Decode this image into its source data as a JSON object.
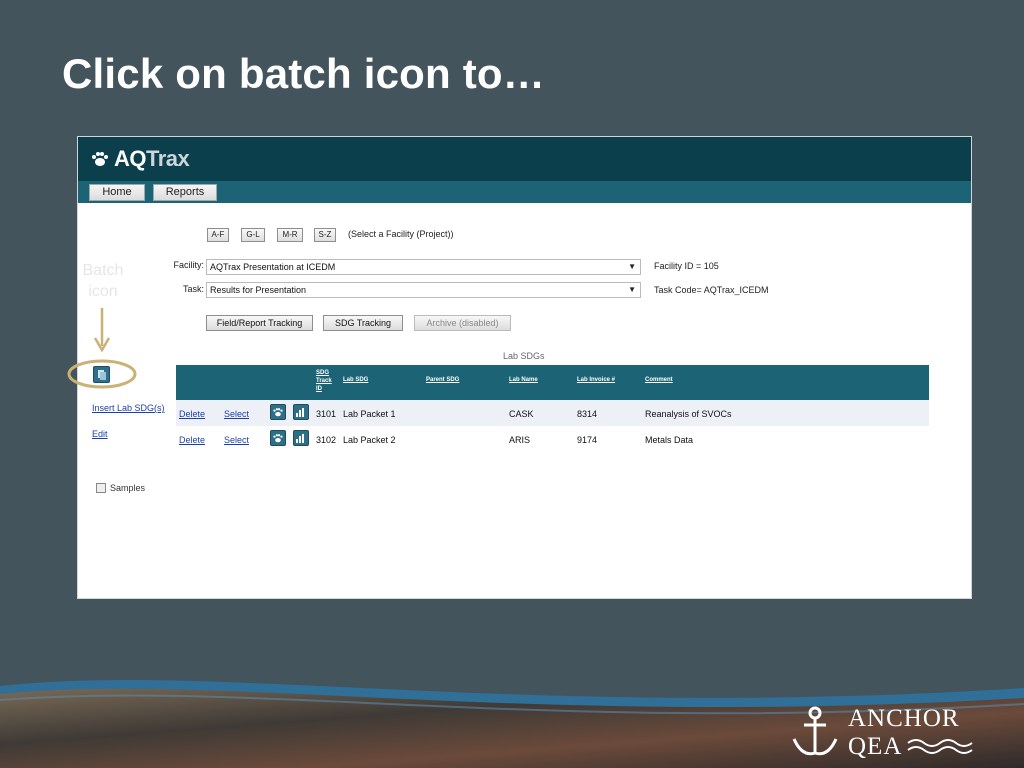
{
  "slide": {
    "title": "Click on batch icon to…"
  },
  "annotation": {
    "batch_line1": "Batch",
    "batch_line2": "icon"
  },
  "app": {
    "logo": {
      "prefix": "AQ",
      "suffix": "Trax"
    },
    "nav": {
      "home": "Home",
      "reports": "Reports"
    },
    "filters": {
      "af": "A-F",
      "gl": "G-L",
      "mr": "M-R",
      "sz": "S-Z",
      "hint": "(Select a Facility (Project))"
    },
    "facility": {
      "label": "Facility:",
      "value": "AQTrax Presentation at ICEDM",
      "info": "Facility ID = 105"
    },
    "task": {
      "label": "Task:",
      "value": "Results for Presentation",
      "info": "Task Code= AQTrax_ICEDM"
    },
    "actions": {
      "field_report": "Field/Report Tracking",
      "sdg_tracking": "SDG Tracking",
      "archive": "Archive (disabled)"
    },
    "left": {
      "insert": "Insert Lab SDG(s)",
      "edit": "Edit",
      "samples": "Samples"
    },
    "table": {
      "caption": "Lab SDGs",
      "headers": {
        "sdg_track_1": "SDG",
        "sdg_track_2": "Track",
        "sdg_track_3": "ID",
        "lab_sdg": "Lab SDG",
        "parent_sdg": "Parent SDG",
        "lab_name": "Lab Name",
        "lab_invoice": "Lab Invoice #",
        "comment": "Comment"
      },
      "rows": [
        {
          "delete": "Delete",
          "select": "Select",
          "id": "3101",
          "lab_sdg": "Lab Packet 1",
          "parent_sdg": "",
          "lab_name": "CASK",
          "invoice": "8314",
          "comment": "Reanalysis of SVOCs"
        },
        {
          "delete": "Delete",
          "select": "Select",
          "id": "3102",
          "lab_sdg": "Lab Packet 2",
          "parent_sdg": "",
          "lab_name": "ARIS",
          "invoice": "9174",
          "comment": "Metals Data"
        }
      ]
    }
  },
  "brand": {
    "line1": "ANCHOR",
    "line2": "QEA"
  },
  "colors": {
    "background": "#44545d",
    "header": "#0c3f4c",
    "accent": "#1c6475",
    "annotation": "#c9b274"
  }
}
